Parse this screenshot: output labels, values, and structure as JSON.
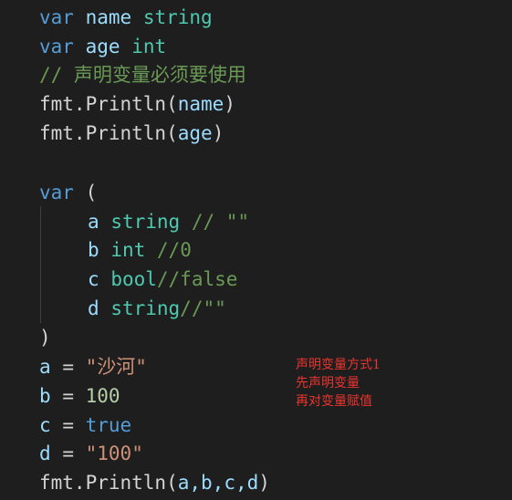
{
  "code": {
    "l1": {
      "kw": "var",
      "name": "name",
      "type": "string"
    },
    "l2": {
      "kw": "var",
      "name": "age",
      "type": "int"
    },
    "l3": {
      "comment": "// 声明变量必须要使用"
    },
    "l4": {
      "pkg": "fmt.",
      "fn": "Println",
      "open": "(",
      "arg": "name",
      "close": ")"
    },
    "l5": {
      "pkg": "fmt.",
      "fn": "Println",
      "open": "(",
      "arg": "age",
      "close": ")"
    },
    "l7": {
      "kw": "var",
      "paren": "("
    },
    "l8": {
      "name": "a",
      "type": "string",
      "comment": "// \"\""
    },
    "l9": {
      "name": "b",
      "type": "int",
      "comment": "//0"
    },
    "l10": {
      "name": "c",
      "type": "bool",
      "comment": "//false"
    },
    "l11": {
      "name": "d",
      "type": "string",
      "comment": "//\"\""
    },
    "l12": {
      "paren": ")"
    },
    "l13": {
      "name": "a",
      "op": "=",
      "value": "\"沙河\""
    },
    "l14": {
      "name": "b",
      "op": "=",
      "value": "100"
    },
    "l15": {
      "name": "c",
      "op": "=",
      "value": "true"
    },
    "l16": {
      "name": "d",
      "op": "=",
      "value": "\"100\""
    },
    "l17": {
      "pkg": "fmt.",
      "fn": "Println",
      "open": "(",
      "args": "a,b,c,d",
      "close": ")"
    }
  },
  "annotation": {
    "line1": "声明变量方式1",
    "line2": "先声明变量",
    "line3": "再对变量赋值"
  },
  "colors": {
    "background": "#1e1e1e",
    "keyword": "#569cd6",
    "variable": "#9cdcfe",
    "type": "#4ec9b0",
    "comment": "#6a9955",
    "string": "#ce9178",
    "number": "#b5cea8",
    "annotation": "#e8342f"
  }
}
